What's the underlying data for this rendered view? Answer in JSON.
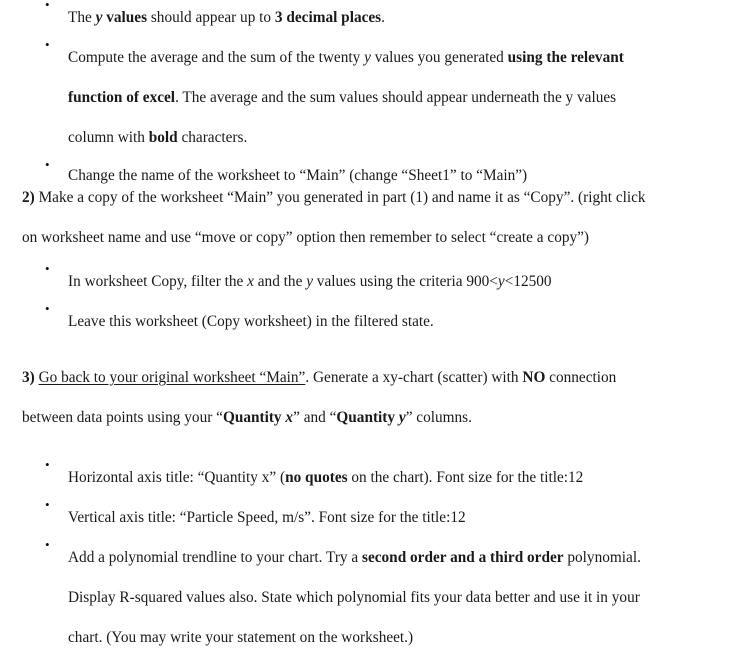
{
  "document": {
    "type": "assignment-instructions",
    "background_color": "#ffffff",
    "text_color": "#1a1a1a",
    "bullet_glyph": "•"
  },
  "section_1_bullets": {
    "bullet_1": {
      "line_1": {
        "run_1": "The ",
        "run_2": "y",
        "run_3": " values",
        "run_4": " should appear up to ",
        "run_5": "3 decimal places",
        "run_6": "."
      }
    },
    "bullet_2": {
      "line_1": {
        "run_1": "Compute the average and the sum of the twenty ",
        "run_2": "y",
        "run_3": " values you generated ",
        "run_4": "using the relevant"
      },
      "line_2": {
        "run_1": "function of excel",
        "run_2": ". The average and the sum values should appear underneath the y values"
      },
      "line_3": {
        "run_1": "column with ",
        "run_2": "bold",
        "run_3": " characters."
      }
    },
    "bullet_3": {
      "line_1": {
        "run_1": "Change the name of the worksheet to “Main” (change “Sheet1” to “Main”)"
      }
    }
  },
  "section_2": {
    "number": "2)",
    "line_1": {
      "run_1": " Make a copy of the worksheet “Main” you generated in part (1) and name it as “Copy”. (right click"
    },
    "line_2": {
      "run_1": "on worksheet name and use “move or copy” option then remember to select “create a copy”)"
    },
    "bullets": {
      "bullet_1": {
        "line_1": {
          "run_1": "In worksheet Copy, filter the ",
          "run_2": "x",
          "run_3": " and the ",
          "run_4": "y",
          "run_5": " values using the criteria  900<",
          "run_6": "y",
          "run_7": "<12500"
        }
      },
      "bullet_2": {
        "line_1": {
          "run_1": "Leave this worksheet (Copy worksheet) in the filtered state."
        }
      }
    }
  },
  "section_3": {
    "number": "3)",
    "line_1": {
      "run_1": " ",
      "run_2": "Go back to your original worksheet “Main”",
      "run_3": ". Generate a xy-chart (scatter) with ",
      "run_4": "NO",
      "run_5": " connection"
    },
    "line_2": {
      "run_1": "between data points using your “",
      "run_2": "Quantity ",
      "run_3": "x",
      "run_4": "” and “",
      "run_5": "Quantity ",
      "run_6": "y",
      "run_7": "” columns."
    },
    "bullets": {
      "bullet_1": {
        "line_1": {
          "run_1": "Horizontal axis title: “Quantity x” (",
          "run_2": "no quotes",
          "run_3": " on the chart). Font size for the title:12"
        }
      },
      "bullet_2": {
        "line_1": {
          "run_1": "Vertical axis title: “Particle Speed, m/s”. Font size for the title:12"
        }
      },
      "bullet_3": {
        "line_1": {
          "run_1": "Add a polynomial trendline to your chart. Try a ",
          "run_2": "second order and a third order",
          "run_3": " polynomial."
        },
        "line_2": {
          "run_1": "Display R-squared values also. State which polynomial fits your data better and use it in your"
        },
        "line_3": {
          "run_1": "chart. (You may write your statement on the worksheet.)"
        }
      }
    }
  }
}
